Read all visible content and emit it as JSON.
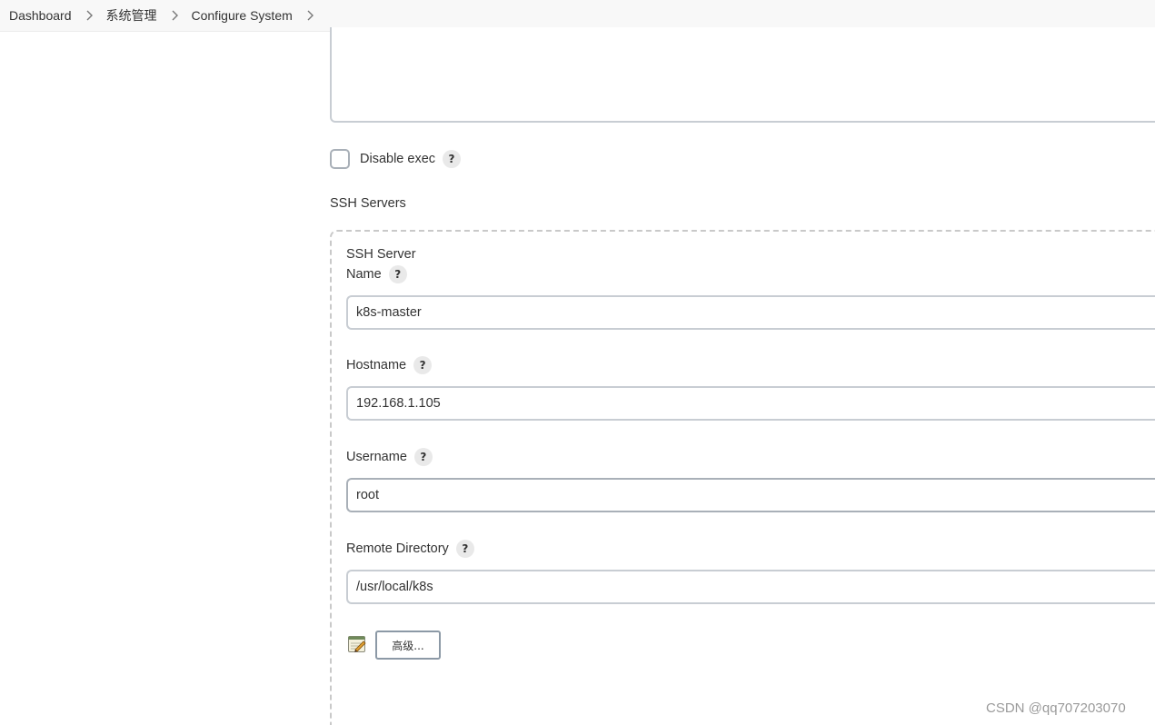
{
  "breadcrumb": {
    "items": [
      "Dashboard",
      "系统管理",
      "Configure System"
    ]
  },
  "exec": {
    "disable_label": "Disable exec",
    "help_glyph": "?"
  },
  "ssh_servers": {
    "section_title": "SSH Servers",
    "server_heading": "SSH Server",
    "fields": {
      "name": {
        "label": "Name",
        "value": "k8s-master"
      },
      "hostname": {
        "label": "Hostname",
        "value": "192.168.1.105"
      },
      "username": {
        "label": "Username",
        "value": "root"
      },
      "remote_directory": {
        "label": "Remote Directory",
        "value": "/usr/local/k8s"
      }
    },
    "advanced_label": "高级..."
  },
  "watermark": "CSDN @qq707203070",
  "colors": {
    "input_border": "#c8cdd3",
    "dashed_border": "#c9c9c9",
    "help_bg": "#e9e9e9"
  }
}
